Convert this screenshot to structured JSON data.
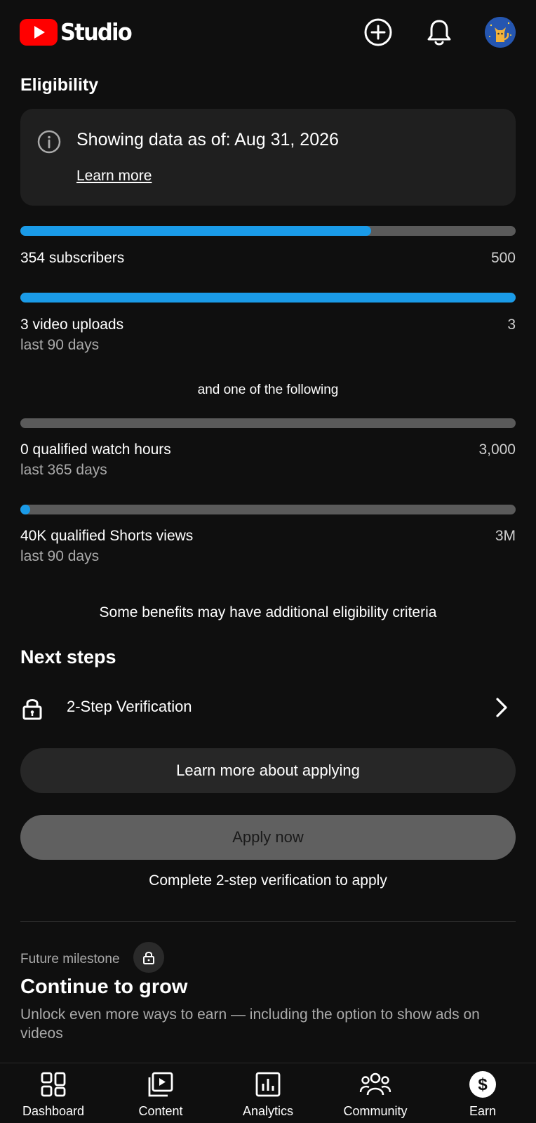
{
  "header": {
    "logo_text": "Studio",
    "icons": {
      "create": "create-plus-icon",
      "notifications": "bell-icon",
      "avatar": "cat-avatar"
    }
  },
  "eligibility": {
    "title": "Eligibility",
    "info": {
      "text": "Showing data as of: Aug 31, 2026",
      "link": "Learn more",
      "icon": "info-icon"
    },
    "requirements": [
      {
        "label": "354 subscribers",
        "sub": "",
        "target": "500",
        "progress": 0.708
      },
      {
        "label": "3 video uploads",
        "sub": "last 90 days",
        "target": "3",
        "progress": 1.0
      }
    ],
    "separator": "and one of the following",
    "alternatives": [
      {
        "label": "0 qualified watch hours",
        "sub": "last 365 days",
        "target": "3,000",
        "progress": 0.0
      },
      {
        "label": "40K qualified Shorts views",
        "sub": "last 90 days",
        "target": "3M",
        "progress": 0.013
      }
    ],
    "note": "Some benefits may have additional eligibility criteria"
  },
  "next_steps": {
    "title": "Next steps",
    "items": [
      {
        "label": "2-Step Verification",
        "icon": "lock-icon"
      }
    ],
    "learn_button": "Learn more about applying",
    "apply_button": "Apply now",
    "apply_hint": "Complete 2-step verification to apply"
  },
  "milestone": {
    "label": "Future milestone",
    "title": "Continue to grow",
    "description": "Unlock even more ways to earn — including the option to show ads on videos"
  },
  "nav": [
    {
      "label": "Dashboard",
      "icon": "dashboard-icon"
    },
    {
      "label": "Content",
      "icon": "content-icon"
    },
    {
      "label": "Analytics",
      "icon": "analytics-icon"
    },
    {
      "label": "Community",
      "icon": "community-icon"
    },
    {
      "label": "Earn",
      "icon": "earn-icon",
      "active": true
    }
  ],
  "colors": {
    "accent": "#1a9be8",
    "background": "#0f0f0f",
    "card": "#1f1f1f",
    "brand_red": "#ff0000"
  }
}
